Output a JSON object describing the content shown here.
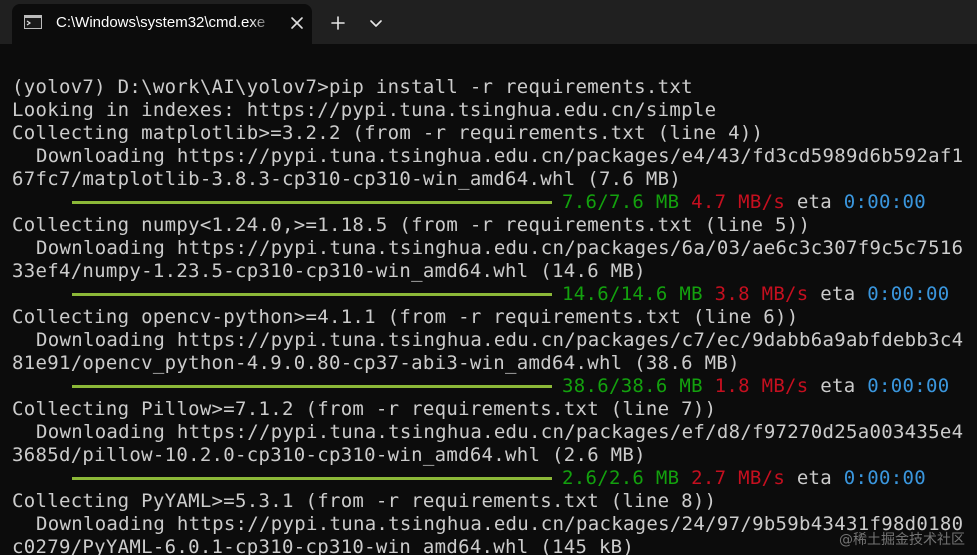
{
  "window": {
    "tab_title": "C:\\Windows\\system32\\cmd.exe",
    "tab_icon": "terminal-icon",
    "close_icon": "close-icon",
    "new_tab_icon": "plus-icon",
    "dropdown_icon": "chevron-down-icon"
  },
  "colors": {
    "background": "#0c0c0c",
    "tabbar": "#202020",
    "text": "#cccccc",
    "progress_bar": "#8cb838",
    "size_green": "#13a10e",
    "speed_red": "#c50f1f",
    "eta_cyan": "#3a96dd"
  },
  "console": {
    "prompt_line": "(yolov7) D:\\work\\AI\\yolov7>pip install -r requirements.txt",
    "index_line": "Looking in indexes: https://pypi.tuna.tsinghua.edu.cn/simple",
    "packages": [
      {
        "collecting": "Collecting matplotlib>=3.2.2 (from -r requirements.txt (line 4))",
        "downloading": "Downloading https://pypi.tuna.tsinghua.edu.cn/packages/e4/43/fd3cd5989d6b592af1",
        "file": "67fc7/matplotlib-3.8.3-cp310-cp310-win_amd64.whl (7.6 MB)",
        "progress": 1.0,
        "size": "7.6/7.6 MB",
        "speed": "4.7 MB/s",
        "eta_label": "eta",
        "eta": "0:00:00"
      },
      {
        "collecting": "Collecting numpy<1.24.0,>=1.18.5 (from -r requirements.txt (line 5))",
        "downloading": "Downloading https://pypi.tuna.tsinghua.edu.cn/packages/6a/03/ae6c3c307f9c5c7516",
        "file": "33ef4/numpy-1.23.5-cp310-cp310-win_amd64.whl (14.6 MB)",
        "progress": 1.0,
        "size": "14.6/14.6 MB",
        "speed": "3.8 MB/s",
        "eta_label": "eta",
        "eta": "0:00:00"
      },
      {
        "collecting": "Collecting opencv-python>=4.1.1 (from -r requirements.txt (line 6))",
        "downloading": "Downloading https://pypi.tuna.tsinghua.edu.cn/packages/c7/ec/9dabb6a9abfdebb3c4",
        "file": "81e91/opencv_python-4.9.0.80-cp37-abi3-win_amd64.whl (38.6 MB)",
        "progress": 1.0,
        "size": "38.6/38.6 MB",
        "speed": "1.8 MB/s",
        "eta_label": "eta",
        "eta": "0:00:00"
      },
      {
        "collecting": "Collecting Pillow>=7.1.2 (from -r requirements.txt (line 7))",
        "downloading": "Downloading https://pypi.tuna.tsinghua.edu.cn/packages/ef/d8/f97270d25a003435e4",
        "file": "3685d/pillow-10.2.0-cp310-cp310-win_amd64.whl (2.6 MB)",
        "progress": 1.0,
        "size": "2.6/2.6 MB",
        "speed": "2.7 MB/s",
        "eta_label": "eta",
        "eta": "0:00:00"
      },
      {
        "collecting": "Collecting PyYAML>=5.3.1 (from -r requirements.txt (line 8))",
        "downloading": "Downloading https://pypi.tuna.tsinghua.edu.cn/packages/24/97/9b59b43431f98d0180",
        "file": "c0279/PyYAML-6.0.1-cp310-cp310-win_amd64.whl (145 kB)"
      }
    ]
  },
  "watermark": "@稀土掘金技术社区"
}
